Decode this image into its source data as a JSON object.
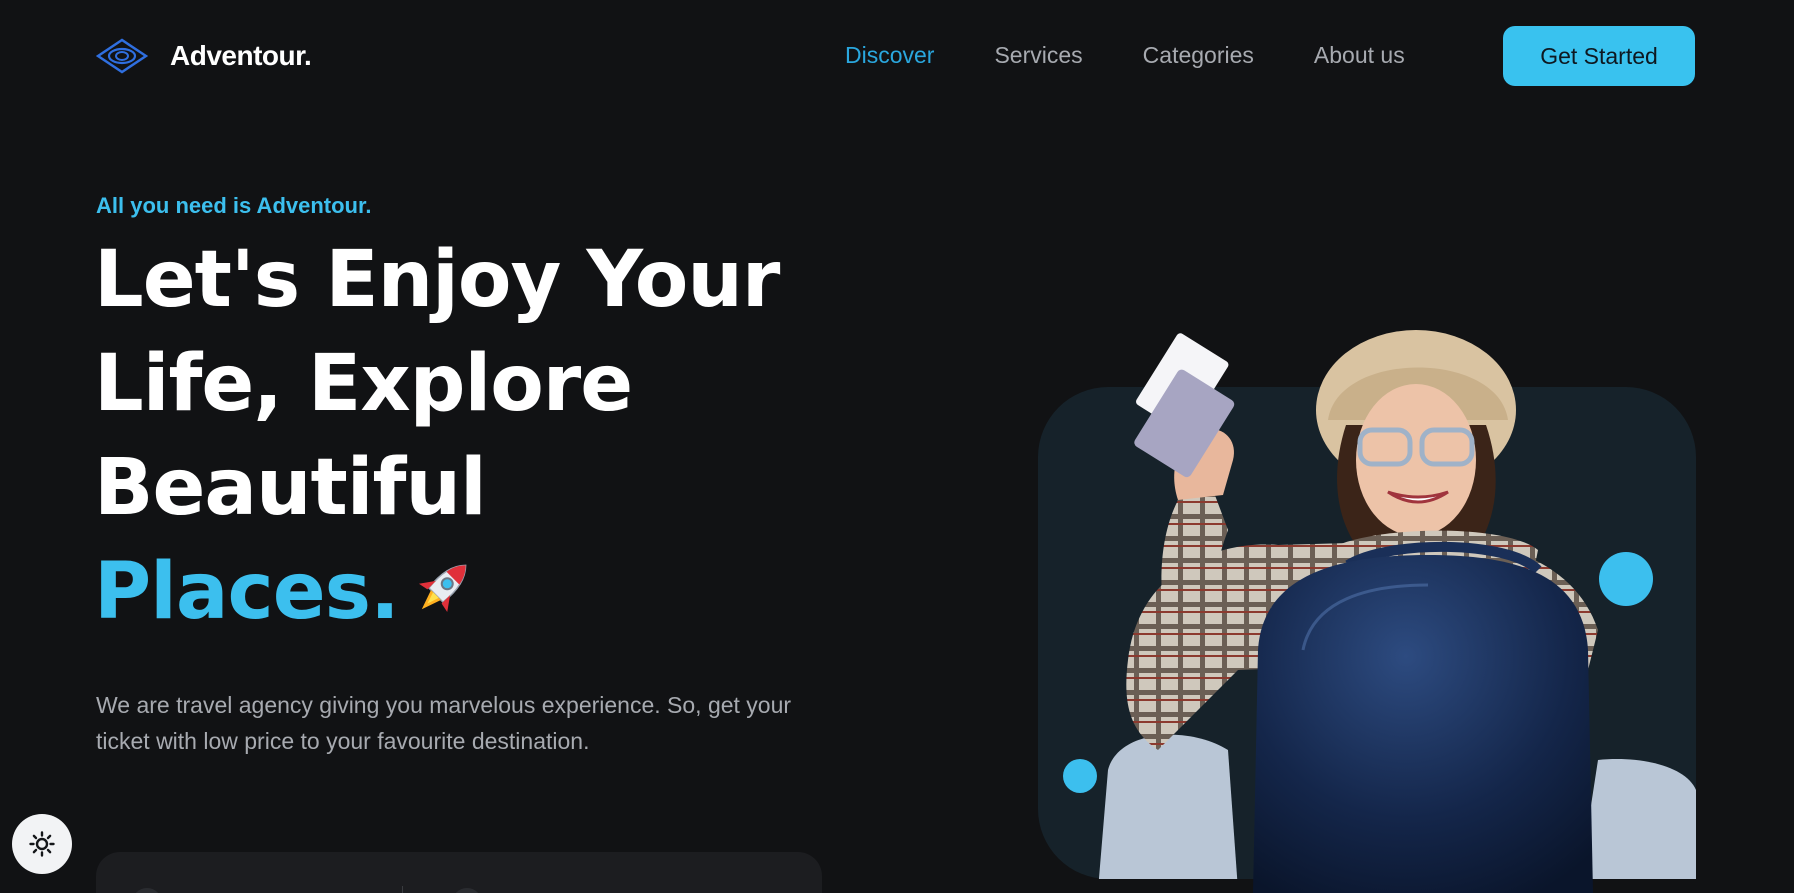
{
  "brand": {
    "name": "Adventour.",
    "accent_color": "#3cbfee",
    "logo_icon": "diamond-eye-icon"
  },
  "nav": {
    "items": [
      {
        "label": "Discover",
        "active": true
      },
      {
        "label": "Services",
        "active": false
      },
      {
        "label": "Categories",
        "active": false
      },
      {
        "label": "About us",
        "active": false
      }
    ],
    "cta_label": "Get Started"
  },
  "hero": {
    "tagline": "All you need is Adventour.",
    "headline_lines": [
      "Let's Enjoy Your",
      "Life, Explore",
      "Beautiful"
    ],
    "headline_accent": "Places.",
    "headline_emoji_icon": "rocket-icon",
    "description": "We are travel agency giving you marvelous experience. So, get your ticket with low price to your favourite destination.",
    "image_icon": "traveler-with-suitcase-photo"
  },
  "theme_toggle": {
    "icon": "sun-icon"
  }
}
